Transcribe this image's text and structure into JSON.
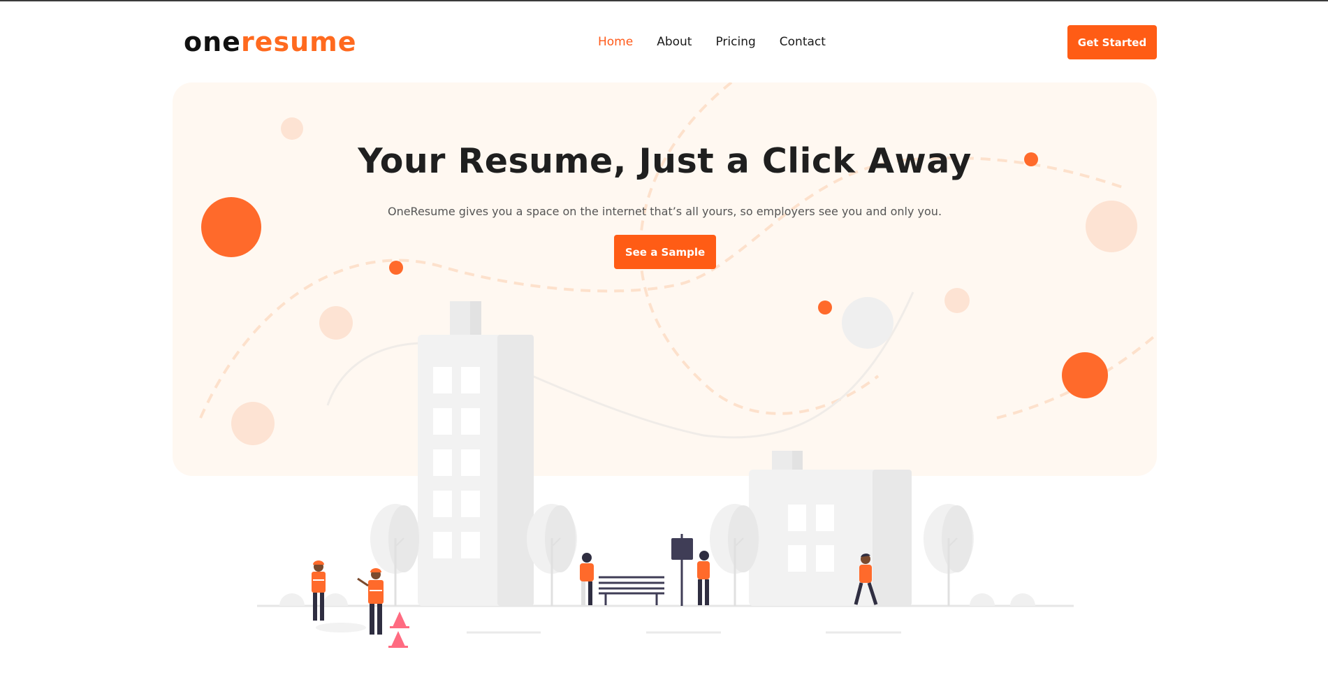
{
  "brand": {
    "logo_part1": "one",
    "logo_part2": "resume",
    "accent": "#ff5c15"
  },
  "nav": {
    "items": [
      {
        "label": "Home",
        "active": true
      },
      {
        "label": "About",
        "active": false
      },
      {
        "label": "Pricing",
        "active": false
      },
      {
        "label": "Contact",
        "active": false
      }
    ]
  },
  "header": {
    "cta_label": "Get Started"
  },
  "hero": {
    "title": "Your Resume, Just a Click Away",
    "subtitle": "OneResume gives you a space on the internet that’s all yours, so employers see you and only you.",
    "cta_label": "See a Sample",
    "background": "#fff8f1"
  },
  "illustration": {
    "icon": "city-street-illustration"
  }
}
